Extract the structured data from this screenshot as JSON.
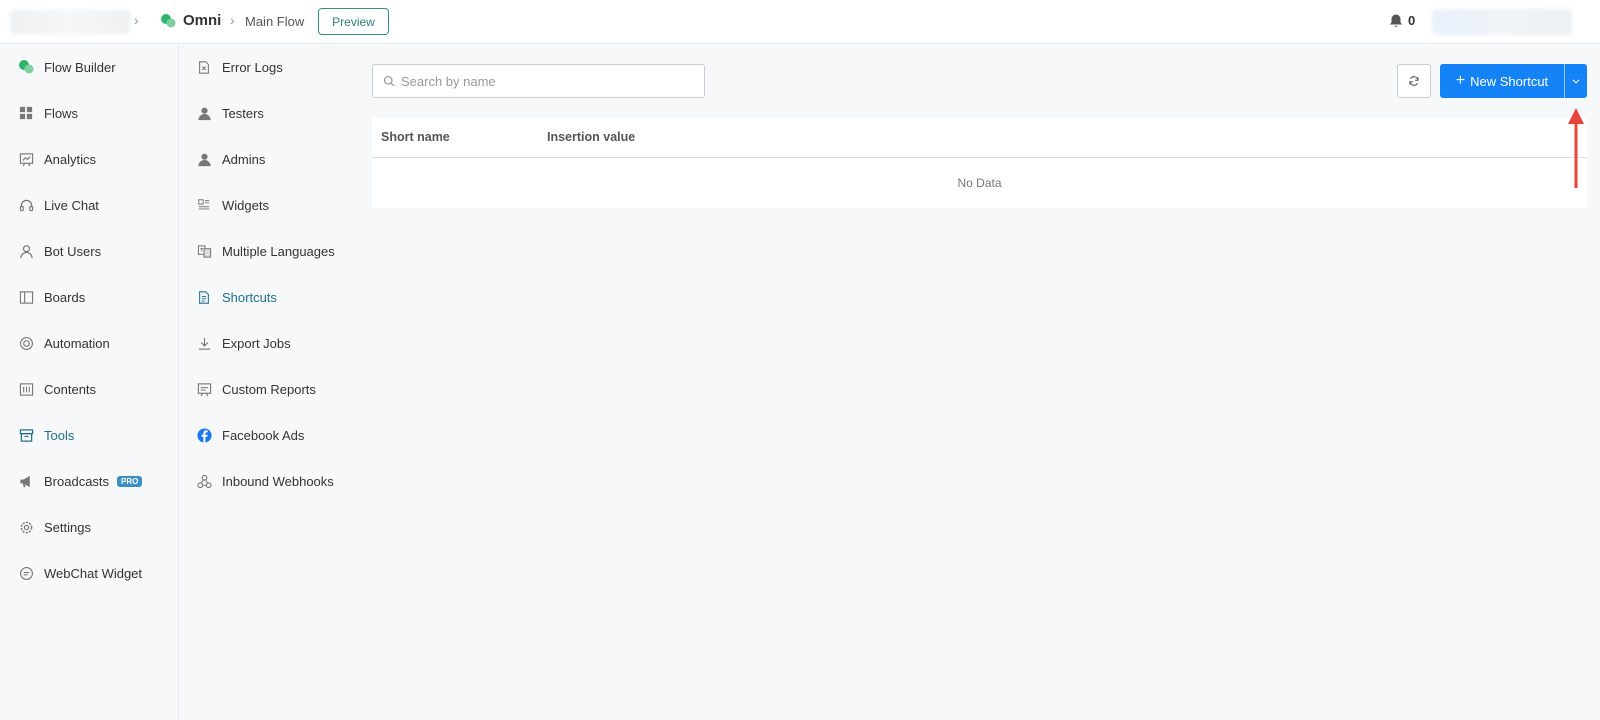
{
  "header": {
    "app_name": "Omni",
    "page": "Main Flow",
    "preview_label": "Preview",
    "notification_count": "0"
  },
  "nav": {
    "items": [
      {
        "label": "Flow Builder",
        "icon": "flow-builder-icon"
      },
      {
        "label": "Flows",
        "icon": "grid-icon"
      },
      {
        "label": "Analytics",
        "icon": "chart-icon"
      },
      {
        "label": "Live Chat",
        "icon": "headset-icon"
      },
      {
        "label": "Bot Users",
        "icon": "user-icon"
      },
      {
        "label": "Boards",
        "icon": "board-icon"
      },
      {
        "label": "Automation",
        "icon": "automation-icon"
      },
      {
        "label": "Contents",
        "icon": "contents-icon"
      },
      {
        "label": "Tools",
        "icon": "toolbox-icon"
      },
      {
        "label": "Broadcasts",
        "icon": "megaphone-icon",
        "badge": "PRO"
      },
      {
        "label": "Settings",
        "icon": "gear-icon"
      },
      {
        "label": "WebChat Widget",
        "icon": "chat-bubble-icon"
      }
    ],
    "active": "Tools"
  },
  "subnav": {
    "items": [
      {
        "label": "Error Logs",
        "icon": "error-file-icon"
      },
      {
        "label": "Testers",
        "icon": "person-icon"
      },
      {
        "label": "Admins",
        "icon": "person-icon"
      },
      {
        "label": "Widgets",
        "icon": "widgets-icon"
      },
      {
        "label": "Multiple Languages",
        "icon": "language-icon"
      },
      {
        "label": "Shortcuts",
        "icon": "document-icon"
      },
      {
        "label": "Export Jobs",
        "icon": "download-icon"
      },
      {
        "label": "Custom Reports",
        "icon": "report-icon"
      },
      {
        "label": "Facebook Ads",
        "icon": "facebook-icon"
      },
      {
        "label": "Inbound Webhooks",
        "icon": "webhook-icon"
      }
    ],
    "active": "Shortcuts"
  },
  "content": {
    "search_placeholder": "Search by name",
    "new_button_label": "New Shortcut",
    "columns": [
      "Short name",
      "Insertion value"
    ],
    "empty_text": "No Data"
  },
  "colors": {
    "primary": "#1483f7",
    "active_nav": "#1f6e8c",
    "annotation_arrow": "#e8453c",
    "brand_green": "#2fb36b"
  }
}
